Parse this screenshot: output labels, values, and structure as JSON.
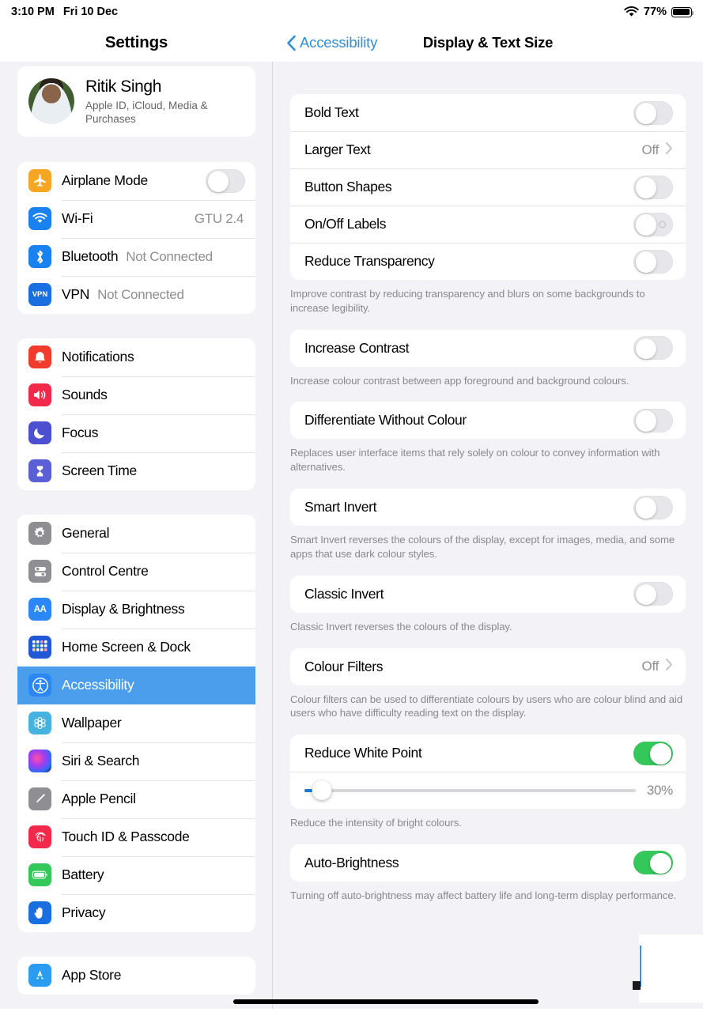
{
  "statusbar": {
    "time": "3:10 PM",
    "date": "Fri 10 Dec",
    "battery_percent": "77%",
    "wifi_icon": "wifi-icon",
    "battery_icon": "battery-icon"
  },
  "sidebar": {
    "title": "Settings",
    "profile": {
      "name": "Ritik Singh",
      "subtitle": "Apple ID, iCloud, Media & Purchases",
      "avatar": "user-avatar"
    },
    "groups": [
      {
        "name": "connectivity",
        "items": [
          {
            "label": "Airplane Mode",
            "icon": "airplane-icon",
            "icon_color": "#f5a623",
            "control": "toggle",
            "toggle_on": false
          },
          {
            "label": "Wi-Fi",
            "icon": "wifi-icon",
            "icon_color": "#1a82f0",
            "value": "GTU 2.4"
          },
          {
            "label": "Bluetooth",
            "icon": "bluetooth-icon",
            "icon_color": "#1a82f0",
            "value": "Not Connected"
          },
          {
            "label": "VPN",
            "icon": "vpn-icon",
            "icon_color": "#1a6fe0",
            "value": "Not Connected"
          }
        ]
      },
      {
        "name": "notifications",
        "items": [
          {
            "label": "Notifications",
            "icon": "notifications-bell-icon",
            "icon_color": "#f03b2d"
          },
          {
            "label": "Sounds",
            "icon": "sounds-speaker-icon",
            "icon_color": "#f2294b"
          },
          {
            "label": "Focus",
            "icon": "focus-moon-icon",
            "icon_color": "#4b4fd0"
          },
          {
            "label": "Screen Time",
            "icon": "screen-time-hourglass-icon",
            "icon_color": "#5b5fd6"
          }
        ]
      },
      {
        "name": "system",
        "items": [
          {
            "label": "General",
            "icon": "gear-icon",
            "icon_color": "#8e8e93"
          },
          {
            "label": "Control Centre",
            "icon": "control-centre-icon",
            "icon_color": "#8e8e93"
          },
          {
            "label": "Display & Brightness",
            "icon": "display-brightness-aa-icon",
            "icon_color": "#2b87f5"
          },
          {
            "label": "Home Screen & Dock",
            "icon": "home-screen-dock-icon",
            "icon_color": "#2257d6"
          },
          {
            "label": "Accessibility",
            "icon": "accessibility-icon",
            "icon_color": "#2b87f5",
            "selected": true
          },
          {
            "label": "Wallpaper",
            "icon": "wallpaper-icon",
            "icon_color": "#45b3e0"
          },
          {
            "label": "Siri & Search",
            "icon": "siri-icon",
            "icon_color": "#2b2b33"
          },
          {
            "label": "Apple Pencil",
            "icon": "apple-pencil-icon",
            "icon_color": "#8e8e93"
          },
          {
            "label": "Touch ID & Passcode",
            "icon": "touch-id-fingerprint-icon",
            "icon_color": "#f2294b"
          },
          {
            "label": "Battery",
            "icon": "battery-icon",
            "icon_color": "#34c759"
          },
          {
            "label": "Privacy",
            "icon": "privacy-hand-icon",
            "icon_color": "#1a6fe0"
          }
        ]
      },
      {
        "name": "stores",
        "items": [
          {
            "label": "App Store",
            "icon": "app-store-icon",
            "icon_color": "#2b9cf0"
          }
        ]
      }
    ]
  },
  "main": {
    "back_label": "Accessibility",
    "title": "Display & Text Size",
    "sections": [
      {
        "name": "text-options",
        "rows": [
          {
            "label": "Bold Text",
            "control": "toggle",
            "toggle_on": false
          },
          {
            "label": "Larger Text",
            "control": "disclosure",
            "value": "Off"
          },
          {
            "label": "Button Shapes",
            "control": "toggle",
            "toggle_on": false
          },
          {
            "label": "On/Off Labels",
            "control": "toggle",
            "toggle_on": false,
            "off_label_mark": true
          },
          {
            "label": "Reduce Transparency",
            "control": "toggle",
            "toggle_on": false
          }
        ],
        "footnote": "Improve contrast by reducing transparency and blurs on some backgrounds to increase legibility."
      },
      {
        "name": "increase-contrast",
        "rows": [
          {
            "label": "Increase Contrast",
            "control": "toggle",
            "toggle_on": false
          }
        ],
        "footnote": "Increase colour contrast between app foreground and background colours."
      },
      {
        "name": "differentiate-without-colour",
        "rows": [
          {
            "label": "Differentiate Without Colour",
            "control": "toggle",
            "toggle_on": false
          }
        ],
        "footnote": "Replaces user interface items that rely solely on colour to convey information with alternatives."
      },
      {
        "name": "smart-invert",
        "rows": [
          {
            "label": "Smart Invert",
            "control": "toggle",
            "toggle_on": false
          }
        ],
        "footnote": "Smart Invert reverses the colours of the display, except for images, media, and some apps that use dark colour styles."
      },
      {
        "name": "classic-invert",
        "rows": [
          {
            "label": "Classic Invert",
            "control": "toggle",
            "toggle_on": false
          }
        ],
        "footnote": "Classic Invert reverses the colours of the display."
      },
      {
        "name": "colour-filters",
        "rows": [
          {
            "label": "Colour Filters",
            "control": "disclosure",
            "value": "Off"
          }
        ],
        "footnote": "Colour filters can be used to differentiate colours by users who are colour blind and aid users who have difficulty reading text on the display."
      },
      {
        "name": "reduce-white-point",
        "rows": [
          {
            "label": "Reduce White Point",
            "control": "toggle",
            "toggle_on": true
          },
          {
            "control": "slider",
            "value_label": "30%",
            "value": 30
          }
        ],
        "footnote": "Reduce the intensity of bright colours."
      },
      {
        "name": "auto-brightness",
        "rows": [
          {
            "label": "Auto-Brightness",
            "control": "toggle",
            "toggle_on": true
          }
        ],
        "footnote": "Turning off auto-brightness may affect battery life and long-term display performance."
      }
    ]
  },
  "colors": {
    "accent_blue": "#2f8fd8",
    "selected_row": "#4a9eec",
    "toggle_on_green": "#34c759",
    "slider_fill": "#1479e0",
    "page_bg": "#f2f2f7",
    "secondary_text": "#8e8e93"
  }
}
